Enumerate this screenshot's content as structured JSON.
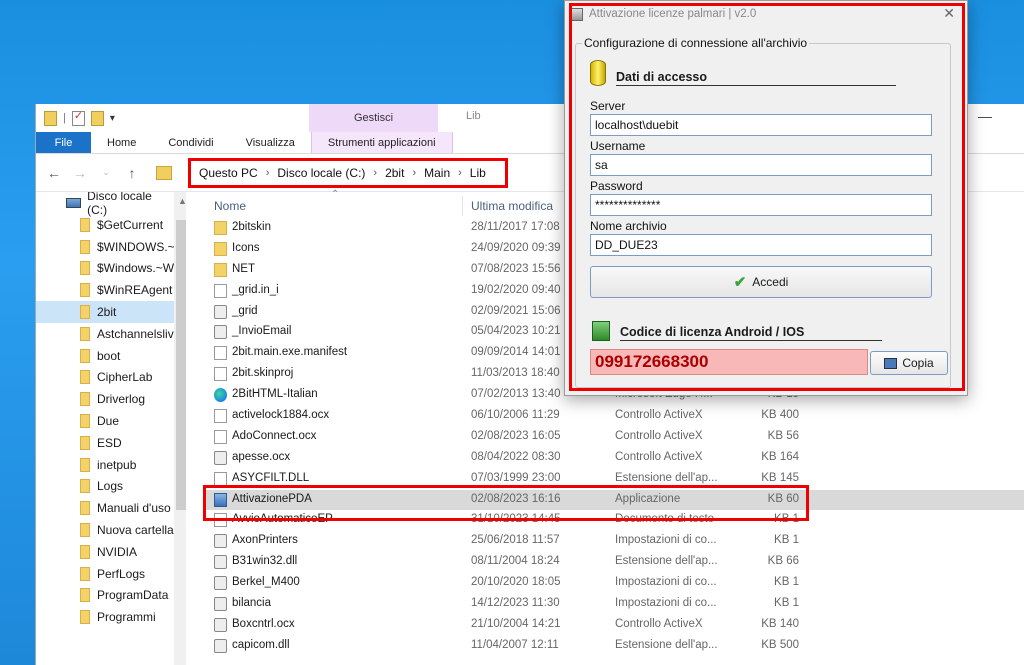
{
  "explorer": {
    "ribbon_tabs": [
      "File",
      "Home",
      "Condividi",
      "Visualizza",
      "Strumenti applicazioni"
    ],
    "context_group": "Gestisci",
    "window_title": "Lib",
    "breadcrumb": [
      "Questo PC",
      "Disco locale (C:)",
      "2bit",
      "Main",
      "Lib"
    ],
    "nav_drive": "Disco locale (C:)",
    "nav_items": [
      "$GetCurrent",
      "$WINDOWS.~B",
      "$Windows.~W",
      "$WinREAgent",
      "2bit",
      "Astchannelslive",
      "boot",
      "CipherLab",
      "Driverlog",
      "Due",
      "ESD",
      "inetpub",
      "Logs",
      "Manuali d'uso",
      "Nuova cartella",
      "NVIDIA",
      "PerfLogs",
      "ProgramData",
      "Programmi"
    ],
    "nav_selected": "2bit",
    "columns": {
      "name": "Nome",
      "date": "Ultima modifica"
    },
    "files": [
      {
        "name": "2bitskin",
        "date": "28/11/2017 17:08",
        "type": "",
        "size": "",
        "icon": "folder-icon"
      },
      {
        "name": "Icons",
        "date": "24/09/2020 09:39",
        "type": "",
        "size": "",
        "icon": "folder-icon"
      },
      {
        "name": "NET",
        "date": "07/08/2023 15:56",
        "type": "",
        "size": "",
        "icon": "folder-icon"
      },
      {
        "name": "_grid.in_i",
        "date": "19/02/2020 09:40",
        "type": "",
        "size": "",
        "icon": "file-icon"
      },
      {
        "name": "_grid",
        "date": "02/09/2021 15:06",
        "type": "",
        "size": "",
        "icon": "gear-file-icon"
      },
      {
        "name": "_InvioEmail",
        "date": "05/04/2023 10:21",
        "type": "",
        "size": "",
        "icon": "gear-file-icon"
      },
      {
        "name": "2bit.main.exe.manifest",
        "date": "09/09/2014 14:01",
        "type": "",
        "size": "",
        "icon": "file-icon"
      },
      {
        "name": "2bit.skinproj",
        "date": "11/03/2013 18:40",
        "type": "",
        "size": "",
        "icon": "file-icon"
      },
      {
        "name": "2BitHTML-Italian",
        "date": "07/02/2013 13:40",
        "type": "Microsoft Edge H...",
        "size": "15 KB",
        "icon": "edge-icon"
      },
      {
        "name": "activelock1884.ocx",
        "date": "06/10/2006 11:29",
        "type": "Controllo ActiveX",
        "size": "400 KB",
        "icon": "file-icon"
      },
      {
        "name": "AdoConnect.ocx",
        "date": "02/08/2023 16:05",
        "type": "Controllo ActiveX",
        "size": "56 KB",
        "icon": "file-icon"
      },
      {
        "name": "apesse.ocx",
        "date": "08/04/2022 08:30",
        "type": "Controllo ActiveX",
        "size": "164 KB",
        "icon": "gear-file-icon"
      },
      {
        "name": "ASYCFILT.DLL",
        "date": "07/03/1999 23:00",
        "type": "Estensione dell'ap...",
        "size": "145 KB",
        "icon": "file-icon"
      },
      {
        "name": "AttivazionePDA",
        "date": "02/08/2023 16:16",
        "type": "Applicazione",
        "size": "60 KB",
        "icon": "app-icon"
      },
      {
        "name": "AvvioAutomaticoEP",
        "date": "31/10/2023 14:45",
        "type": "Documento di testo",
        "size": "1 KB",
        "icon": "file-icon"
      },
      {
        "name": "AxonPrinters",
        "date": "25/06/2018 11:57",
        "type": "Impostazioni di co...",
        "size": "1 KB",
        "icon": "gear-file-icon"
      },
      {
        "name": "B31win32.dll",
        "date": "08/11/2004 18:24",
        "type": "Estensione dell'ap...",
        "size": "66 KB",
        "icon": "gear-file-icon"
      },
      {
        "name": "Berkel_M400",
        "date": "20/10/2020 18:05",
        "type": "Impostazioni di co...",
        "size": "1 KB",
        "icon": "gear-file-icon"
      },
      {
        "name": "bilancia",
        "date": "14/12/2023 11:30",
        "type": "Impostazioni di co...",
        "size": "1 KB",
        "icon": "gear-file-icon"
      },
      {
        "name": "Boxcntrl.ocx",
        "date": "21/10/2004 14:21",
        "type": "Controllo ActiveX",
        "size": "140 KB",
        "icon": "gear-file-icon"
      },
      {
        "name": "capicom.dll",
        "date": "11/04/2007 12:11",
        "type": "Estensione dell'ap...",
        "size": "500 KB",
        "icon": "gear-file-icon"
      }
    ],
    "selected_file": "AttivazionePDA"
  },
  "dialog": {
    "title": "Attivazione licenze palmari | v2.0",
    "group_label": "Configurazione di connessione all'archivio",
    "access_section": "Dati di accesso",
    "fields": {
      "server_label": "Server",
      "server_value": "localhost\\duebit",
      "username_label": "Username",
      "username_value": "sa",
      "password_label": "Password",
      "password_value": "**************",
      "archive_label": "Nome archivio",
      "archive_value": "DD_DUE23"
    },
    "login_button": "Accedi",
    "license_section": "Codice di licenza Android / IOS",
    "license_code": "099172668300",
    "copy_button": "Copia"
  },
  "colors": {
    "accent": "#1a73c8",
    "highlight_red": "#e00000",
    "license_bg": "#f8b8b8",
    "context_tab": "#efd9f9"
  }
}
